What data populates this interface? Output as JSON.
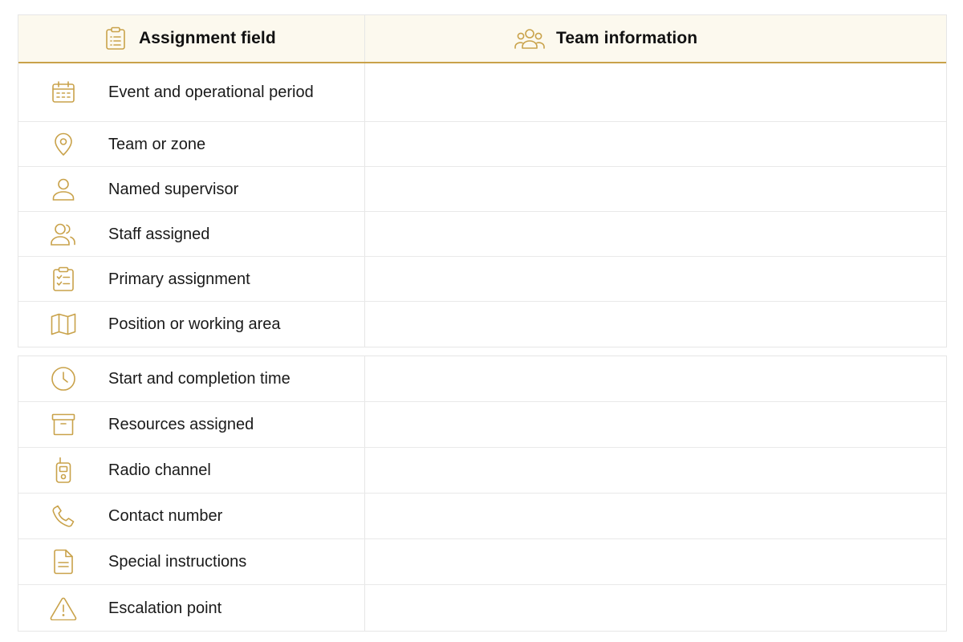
{
  "header": {
    "field_title": "Assignment field",
    "info_title": "Team information",
    "field_icon": "clipboard-list-icon",
    "info_icon": "team-icon"
  },
  "accent_color": "#c9a24a",
  "section1": [
    {
      "label": "Event and operational period",
      "icon": "calendar-icon",
      "value": ""
    },
    {
      "label": "Team or zone",
      "icon": "map-pin-icon",
      "value": ""
    },
    {
      "label": "Named supervisor",
      "icon": "user-icon",
      "value": ""
    },
    {
      "label": "Staff assigned",
      "icon": "users-icon",
      "value": ""
    },
    {
      "label": "Primary assignment",
      "icon": "clipboard-check-icon",
      "value": ""
    },
    {
      "label": "Position or working area",
      "icon": "map-icon",
      "value": ""
    }
  ],
  "section2": [
    {
      "label": "Start and completion time",
      "icon": "clock-icon",
      "value": ""
    },
    {
      "label": "Resources assigned",
      "icon": "archive-box-icon",
      "value": ""
    },
    {
      "label": "Radio channel",
      "icon": "radio-icon",
      "value": ""
    },
    {
      "label": "Contact number",
      "icon": "phone-icon",
      "value": ""
    },
    {
      "label": "Special instructions",
      "icon": "document-icon",
      "value": ""
    },
    {
      "label": "Escalation point",
      "icon": "warning-icon",
      "value": ""
    }
  ]
}
